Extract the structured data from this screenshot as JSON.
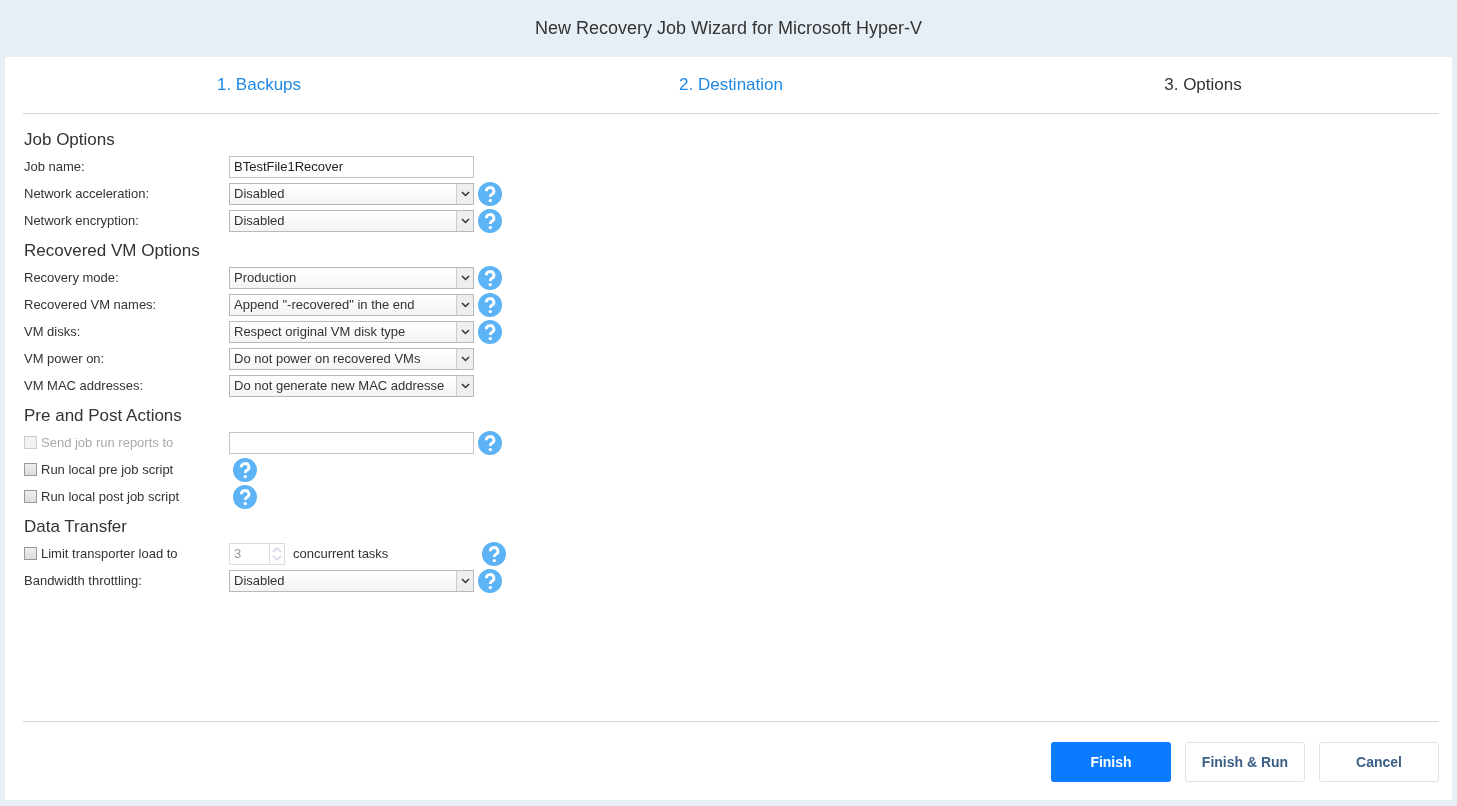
{
  "window": {
    "title": "New Recovery Job Wizard for Microsoft Hyper-V"
  },
  "steps": [
    {
      "label": "1. Backups",
      "selected": false
    },
    {
      "label": "2. Destination",
      "selected": false
    },
    {
      "label": "3. Options",
      "selected": true
    }
  ],
  "sections": [
    {
      "title": "Job Options",
      "rows": [
        {
          "kind": "text",
          "label": "Job name:",
          "value": "BTestFile1Recover",
          "help": false
        },
        {
          "kind": "select",
          "label": "Network acceleration:",
          "value": "Disabled",
          "help": true
        },
        {
          "kind": "select",
          "label": "Network encryption:",
          "value": "Disabled",
          "help": true
        }
      ]
    },
    {
      "title": "Recovered VM Options",
      "rows": [
        {
          "kind": "select",
          "label": "Recovery mode:",
          "value": "Production",
          "help": true
        },
        {
          "kind": "select",
          "label": "Recovered VM names:",
          "value": "Append \"-recovered\" in the end",
          "help": true
        },
        {
          "kind": "select",
          "label": "VM disks:",
          "value": "Respect original VM disk type",
          "help": true
        },
        {
          "kind": "select",
          "label": "VM power on:",
          "value": "Do not power on recovered VMs",
          "help": false
        },
        {
          "kind": "select",
          "label": "VM MAC addresses:",
          "value": "Do not generate new MAC addresse",
          "help": false
        }
      ]
    },
    {
      "title": "Pre and Post Actions",
      "rows": [
        {
          "kind": "checkfield",
          "label": "Send job run reports to",
          "checked": false,
          "disabled": true,
          "help": true
        },
        {
          "kind": "check",
          "label": "Run local pre job script",
          "checked": false,
          "disabled": false,
          "help": true
        },
        {
          "kind": "check",
          "label": "Run local post job script",
          "checked": false,
          "disabled": false,
          "help": true
        }
      ]
    },
    {
      "title": "Data Transfer",
      "rows": [
        {
          "kind": "spinner",
          "label": "Limit transporter load to",
          "checked": false,
          "disabled": false,
          "value": "3",
          "suffix": "concurrent tasks",
          "help": true
        },
        {
          "kind": "select",
          "label": "Bandwidth throttling:",
          "value": "Disabled",
          "help": true
        }
      ]
    }
  ],
  "buttons": [
    {
      "label": "Finish",
      "kind": "primary"
    },
    {
      "label": "Finish & Run",
      "kind": "secondary"
    },
    {
      "label": "Cancel",
      "kind": "secondary"
    }
  ]
}
